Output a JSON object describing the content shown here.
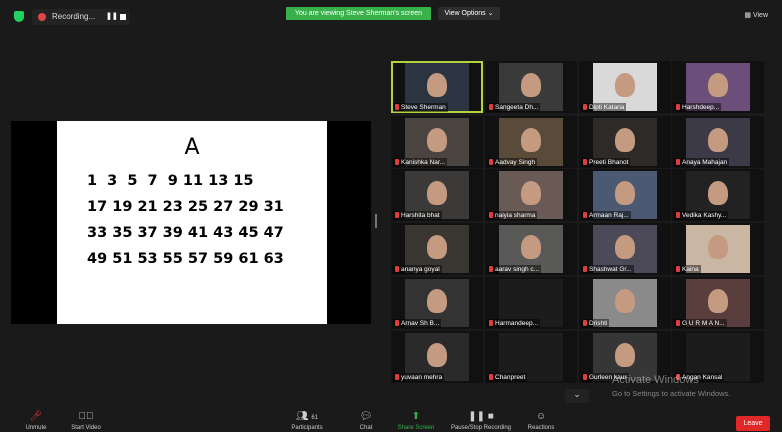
{
  "recording": {
    "label": "Recording..."
  },
  "banner": {
    "viewing_text": "You are viewing Steve Sherman's screen",
    "view_options": "View Options ⌄"
  },
  "header": {
    "view_label": "▦ View"
  },
  "slide": {
    "title": "A",
    "rows": [
      "1  3  5  7  9 11 13 15",
      "17 19 21 23 25 27 29 31",
      "33 35 37 39 41 43 45 47",
      "49 51 53 55 57 59 61 63"
    ]
  },
  "participants": [
    "Steve Sherman",
    "Sangeeta Dh...",
    "Dipti Kataria",
    "Harshdeep...",
    "Kanishka Nar...",
    "Aadvay Singh",
    "Preeti Bhanot",
    "Anaya Mahajan",
    "Harshita bhat",
    "naiyia sharma",
    "Armaan Raj...",
    "Vedika Kashy...",
    "ananya goyal",
    "aarav singh c...",
    "Shashwat Gr...",
    "Kaina",
    "Arnav Sh B...",
    "Harmandeep...",
    "Drishti",
    "G U R M A N...",
    "yuvaan mehra",
    "Chanpreet",
    "Gurleen kaur",
    "Angan Kansal"
  ],
  "watermark": {
    "line1": "Activate Windows",
    "line2": "Go to Settings to activate Windows."
  },
  "toolbar": {
    "unmute": "Unmute",
    "start_video": "Start Video",
    "participants_count": "61",
    "participants": "Participants",
    "chat": "Chat",
    "share_screen": "Share Screen",
    "pause_stop_recording": "Pause/Stop Recording",
    "reactions": "Reactions",
    "leave": "Leave"
  },
  "colors": {
    "banner_green": "#39b14a",
    "active_speaker": "#b3d23b",
    "leave_red": "#e02828",
    "muted_red": "#e03c3c"
  }
}
